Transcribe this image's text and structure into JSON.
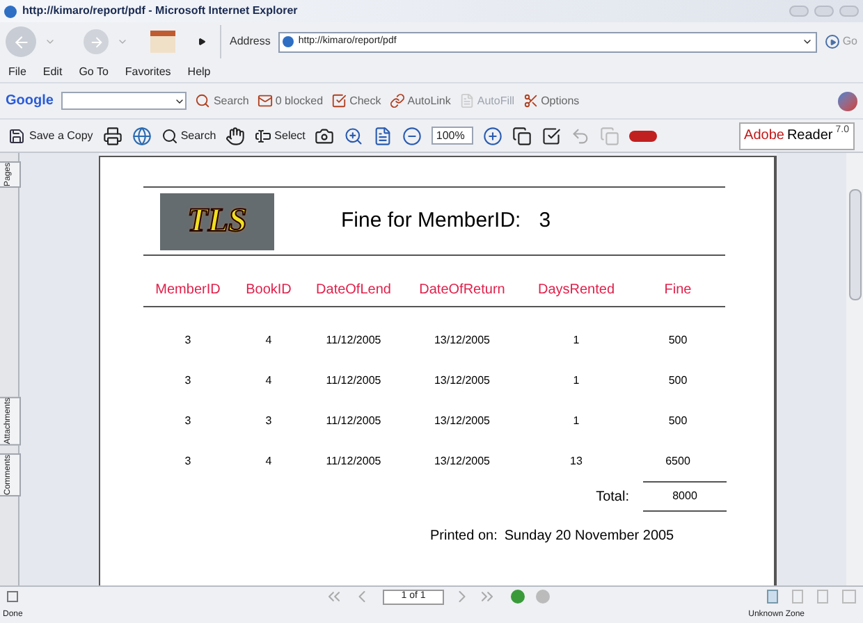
{
  "window": {
    "title": "http://kimaro/report/pdf - Microsoft Internet Explorer"
  },
  "address_bar": {
    "label": "Address",
    "value": "http://kimaro/report/pdf",
    "go": "Go"
  },
  "menu": [
    "File",
    "Edit",
    "Go To",
    "Favorites",
    "Help"
  ],
  "google_toolbar": {
    "logo": "Google",
    "items": [
      {
        "label": "Search",
        "disabled": false
      },
      {
        "label": "0 blocked",
        "disabled": false
      },
      {
        "label": "Check",
        "disabled": false
      },
      {
        "label": "AutoLink",
        "disabled": false
      },
      {
        "label": "AutoFill",
        "disabled": true
      },
      {
        "label": "Options",
        "disabled": false
      }
    ]
  },
  "reader_toolbar": {
    "save": "Save a Copy",
    "search": "Search",
    "select": "Select",
    "zoom": "100%",
    "brand": "Adobe",
    "product": "Reader",
    "version": "7.0"
  },
  "side_tabs": [
    "Pages",
    "Attachments",
    "Comments"
  ],
  "report": {
    "logo": "TLS",
    "title": "Fine for MemberID:",
    "member_id": "3",
    "columns": [
      "MemberID",
      "BookID",
      "DateOfLend",
      "DateOfReturn",
      "DaysRented",
      "Fine"
    ],
    "rows": [
      [
        "3",
        "4",
        "11/12/2005",
        "13/12/2005",
        "1",
        "500"
      ],
      [
        "3",
        "4",
        "11/12/2005",
        "13/12/2005",
        "1",
        "500"
      ],
      [
        "3",
        "3",
        "11/12/2005",
        "13/12/2005",
        "1",
        "500"
      ],
      [
        "3",
        "4",
        "11/12/2005",
        "13/12/2005",
        "13",
        "6500"
      ]
    ],
    "total_label": "Total:",
    "total": "8000",
    "printed_label": "Printed on:",
    "printed_date": "Sunday 20 November 2005"
  },
  "page_nav": {
    "page": "1 of 1"
  },
  "status_bar": {
    "text": "Done",
    "zone": "Unknown Zone"
  }
}
